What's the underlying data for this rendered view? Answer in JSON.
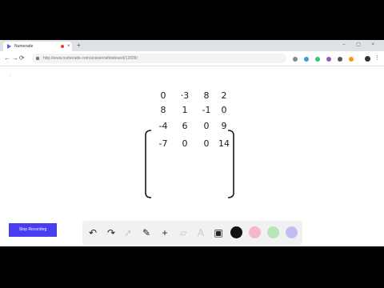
{
  "tab": {
    "title": "Numerade",
    "close": "×",
    "new_tab": "+"
  },
  "window_controls": "– ▢ ×",
  "nav": {
    "back": "←",
    "forward": "→",
    "reload": "⟳",
    "home": "⌂"
  },
  "address_bar": {
    "url": "http://www.numerade.com/answer/whiteboard/12839/"
  },
  "menu": "⋮",
  "stop_button": {
    "label": "Stop Recording"
  },
  "matrix": {
    "rows": [
      [
        "0",
        "·3",
        "8",
        "2"
      ],
      [
        "8",
        "1",
        "-1",
        "0"
      ],
      [
        "-4",
        "6",
        "0",
        "9"
      ],
      [
        "-7",
        "0",
        "0",
        "14"
      ]
    ]
  },
  "toolbar": {
    "tools": [
      {
        "name": "undo-icon",
        "glyph": "↶",
        "enabled": true
      },
      {
        "name": "redo-icon",
        "glyph": "↷",
        "enabled": true
      },
      {
        "name": "cursor-icon",
        "glyph": "➚",
        "enabled": false
      },
      {
        "name": "pen-icon",
        "glyph": "✎",
        "enabled": true
      },
      {
        "name": "add-icon",
        "glyph": "+",
        "enabled": true
      },
      {
        "name": "eraser-icon",
        "glyph": "▱",
        "enabled": false
      },
      {
        "name": "text-icon",
        "glyph": "A",
        "enabled": false
      },
      {
        "name": "image-icon",
        "glyph": "▣",
        "enabled": true
      }
    ],
    "colors": [
      "#111111",
      "#f5b8c8",
      "#b8e6b8",
      "#c0bff5"
    ]
  },
  "extension_colors": [
    "#888888",
    "#3a9ad9",
    "#2ecc71",
    "#9b59b6",
    "#555555",
    "#f39c12"
  ]
}
